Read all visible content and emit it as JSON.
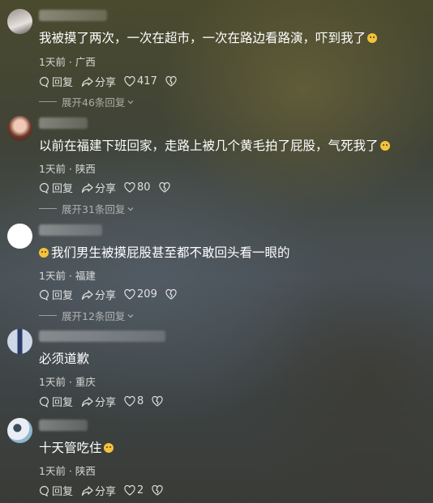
{
  "comments": [
    {
      "text": "我被摸了两次，一次在超市，一次在路边看路演，吓到我了",
      "emoji": "crying-face",
      "time": "1天前",
      "location": "广西",
      "reply_label": "回复",
      "share_label": "分享",
      "likes": "417",
      "replies_label": "展开46条回复"
    },
    {
      "text": "以前在福建下班回家，走路上被几个黄毛拍了屁股，气死我了",
      "emoji": "angry-face",
      "time": "1天前",
      "location": "陕西",
      "reply_label": "回复",
      "share_label": "分享",
      "likes": "80",
      "replies_label": "展开31条回复"
    },
    {
      "text": "我们男生被摸屁股甚至都不敢回头看一眼的",
      "emoji": "crying-face",
      "time": "1天前",
      "location": "福建",
      "reply_label": "回复",
      "share_label": "分享",
      "likes": "209",
      "replies_label": "展开12条回复"
    },
    {
      "text": "必须道歉",
      "time": "1天前",
      "location": "重庆",
      "reply_label": "回复",
      "share_label": "分享",
      "likes": "8"
    },
    {
      "text": "十天管吃住",
      "emoji": "laughing-face",
      "time": "1天前",
      "location": "陕西",
      "reply_label": "回复",
      "share_label": "分享",
      "likes": "2"
    }
  ]
}
